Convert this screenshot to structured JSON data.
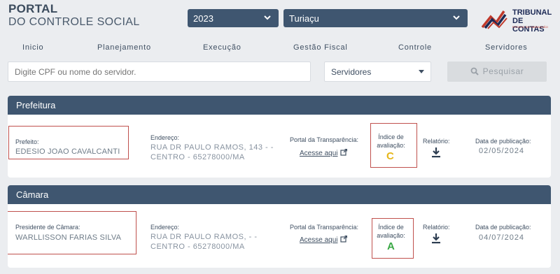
{
  "brand": {
    "title": "PORTAL",
    "subtitle": "DO CONTROLE SOCIAL"
  },
  "filters": {
    "year": "2023",
    "municipality": "Turiaçu"
  },
  "logo": {
    "line1": "TRIBUNAL",
    "line2": "DE CONTAS",
    "tagline": "ESTADO DO MARANHÃO"
  },
  "nav": [
    "Inicio",
    "Planejamento",
    "Execução",
    "Gestão Fiscal",
    "Controle",
    "Servidores"
  ],
  "search": {
    "placeholder": "Digite CPF ou nome do servidor.",
    "role": "Servidores",
    "button": "Pesquisar"
  },
  "cards": [
    {
      "header": "Prefeitura",
      "official_label": "Prefeito:",
      "official_name": "EDESIO JOAO CAVALCANTI",
      "address_label": "Endereço:",
      "address_line1": "RUA DR PAULO RAMOS, 143 - -",
      "address_line2": "CENTRO - 65278000/MA",
      "transparency_label": "Portal da Transparência:",
      "transparency_link": "Acesse aqui",
      "index_label_1": "Índice de",
      "index_label_2": "avaliação:",
      "index_value": "C",
      "index_color": "#e6b619",
      "report_label": "Relatório:",
      "published_label": "Data de publicação:",
      "published_date": "02/05/2024"
    },
    {
      "header": "Câmara",
      "official_label": "Presidente de Câmara:",
      "official_name": "WARLLISSON FARIAS SILVA",
      "address_label": "Endereço:",
      "address_line1": "RUA DR PAULO RAMOS, - -",
      "address_line2": "CENTRO - 65278000/MA",
      "transparency_label": "Portal da Transparência:",
      "transparency_link": "Acesse aqui",
      "index_label_1": "Índice de",
      "index_label_2": "avaliação:",
      "index_value": "A",
      "index_color": "#3aa845",
      "report_label": "Relatório:",
      "published_label": "Data de publicação:",
      "published_date": "04/07/2024"
    }
  ],
  "colors": {
    "header_bar": "#3f5670",
    "annotation_box": "#c0504d",
    "page_bg": "#ebedf0"
  }
}
